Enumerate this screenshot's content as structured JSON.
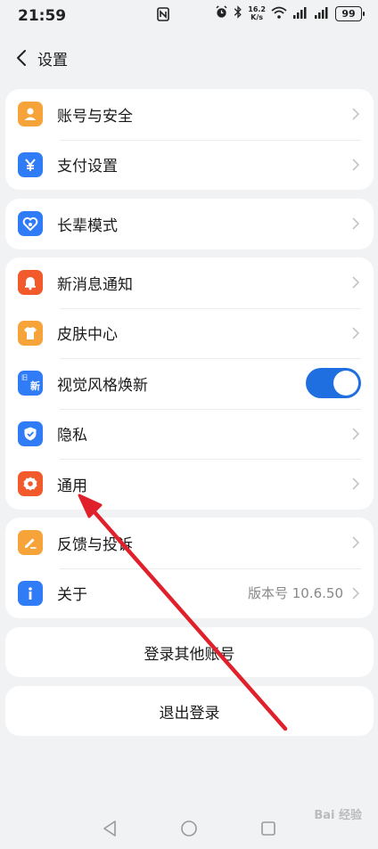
{
  "status_bar": {
    "time": "21:59",
    "net_speed_top": "16.2",
    "net_speed_bottom": "K/s",
    "battery": "99",
    "icons": [
      "nfc-icon",
      "alarm-icon",
      "bluetooth-icon",
      "wifi-icon",
      "signal-icon",
      "signal-icon",
      "battery-icon"
    ]
  },
  "header": {
    "back_icon": "chevron-left-icon",
    "title": "设置"
  },
  "groups": [
    {
      "items": [
        {
          "label": "账号与安全",
          "icon": "person-icon",
          "color": "#f6a33a"
        },
        {
          "label": "支付设置",
          "icon": "yuan-icon",
          "color": "#2f7cf6"
        }
      ]
    },
    {
      "items": [
        {
          "label": "长辈模式",
          "icon": "heart-icon",
          "color": "#2f7cf6"
        }
      ]
    },
    {
      "items": [
        {
          "label": "新消息通知",
          "icon": "bell-icon",
          "color": "#f25a2c"
        },
        {
          "label": "皮肤中心",
          "icon": "shirt-icon",
          "color": "#f6a33a"
        },
        {
          "label": "视觉风格焕新",
          "icon": "refresh-style-icon",
          "color": "#2f7cf6",
          "toggle": true,
          "icon_text_top": "旧",
          "icon_text_bottom": "新"
        },
        {
          "label": "隐私",
          "icon": "shield-icon",
          "color": "#2f7cf6"
        },
        {
          "label": "通用",
          "icon": "gear-icon",
          "color": "#f25a2c"
        }
      ]
    },
    {
      "items": [
        {
          "label": "反馈与投诉",
          "icon": "pencil-icon",
          "color": "#f6a33a"
        },
        {
          "label": "关于",
          "icon": "info-icon",
          "color": "#2f7cf6",
          "value": "版本号 10.6.50"
        }
      ]
    }
  ],
  "buttons": {
    "switch_account": "登录其他账号",
    "logout": "退出登录"
  },
  "nav": {
    "back": "triangle-back-icon",
    "home": "circle-home-icon",
    "recent": "square-recent-icon"
  },
  "watermark": "Bai 经验",
  "colors": {
    "accent_blue": "#2f7cf6",
    "toggle_on": "#1f6fe0",
    "arrow_red": "#e0202a",
    "background": "#f1f2f4"
  }
}
